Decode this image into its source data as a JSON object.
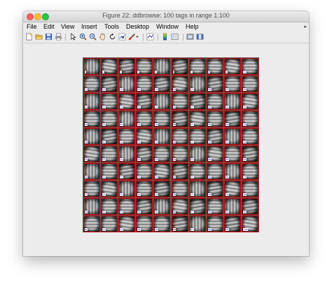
{
  "window": {
    "title": "Figure 22: ddbrowse: 100 tags in range 1:100"
  },
  "menubar": {
    "items": [
      "File",
      "Edit",
      "View",
      "Insert",
      "Tools",
      "Desktop",
      "Window",
      "Help"
    ],
    "overflow_arrow": "▸"
  },
  "toolbar": {
    "icons": [
      "new-figure-icon",
      "open-file-icon",
      "save-icon",
      "print-icon",
      "edit-plot-arrow-icon",
      "zoom-in-icon",
      "zoom-out-icon",
      "pan-hand-icon",
      "rotate-3d-icon",
      "data-cursor-icon",
      "brush-icon",
      "brush-dropdown-icon",
      "link-plot-icon",
      "insert-colorbar-icon",
      "insert-legend-icon",
      "hide-plot-tools-icon",
      "show-plot-tools-icon"
    ]
  },
  "figure": {
    "grid_rows": 10,
    "grid_cols": 10,
    "tile_labels": [
      "1",
      "2",
      "3",
      "4",
      "5",
      "6",
      "7",
      "8",
      "9",
      "10",
      "11",
      "12",
      "13",
      "14",
      "15",
      "16",
      "17",
      "18",
      "19",
      "20",
      "21",
      "22",
      "23",
      "24",
      "25",
      "26",
      "27",
      "28",
      "29",
      "30",
      "31",
      "32",
      "33",
      "34",
      "35",
      "36",
      "37",
      "38",
      "39",
      "40",
      "41",
      "42",
      "43",
      "44",
      "45",
      "46",
      "47",
      "48",
      "49",
      "50",
      "51",
      "52",
      "53",
      "54",
      "55",
      "56",
      "57",
      "58",
      "59",
      "60",
      "61",
      "62",
      "63",
      "64",
      "65",
      "66",
      "67",
      "68",
      "69",
      "70",
      "71",
      "72",
      "73",
      "74",
      "75",
      "76",
      "77",
      "78",
      "79",
      "80",
      "81",
      "82",
      "83",
      "84",
      "85",
      "86",
      "87",
      "88",
      "89",
      "90",
      "91",
      "92",
      "93",
      "94",
      "95",
      "96",
      "97",
      "98",
      "99",
      "100"
    ],
    "tile_border_color": "#cc0000",
    "tag_color": "#0000cc"
  }
}
